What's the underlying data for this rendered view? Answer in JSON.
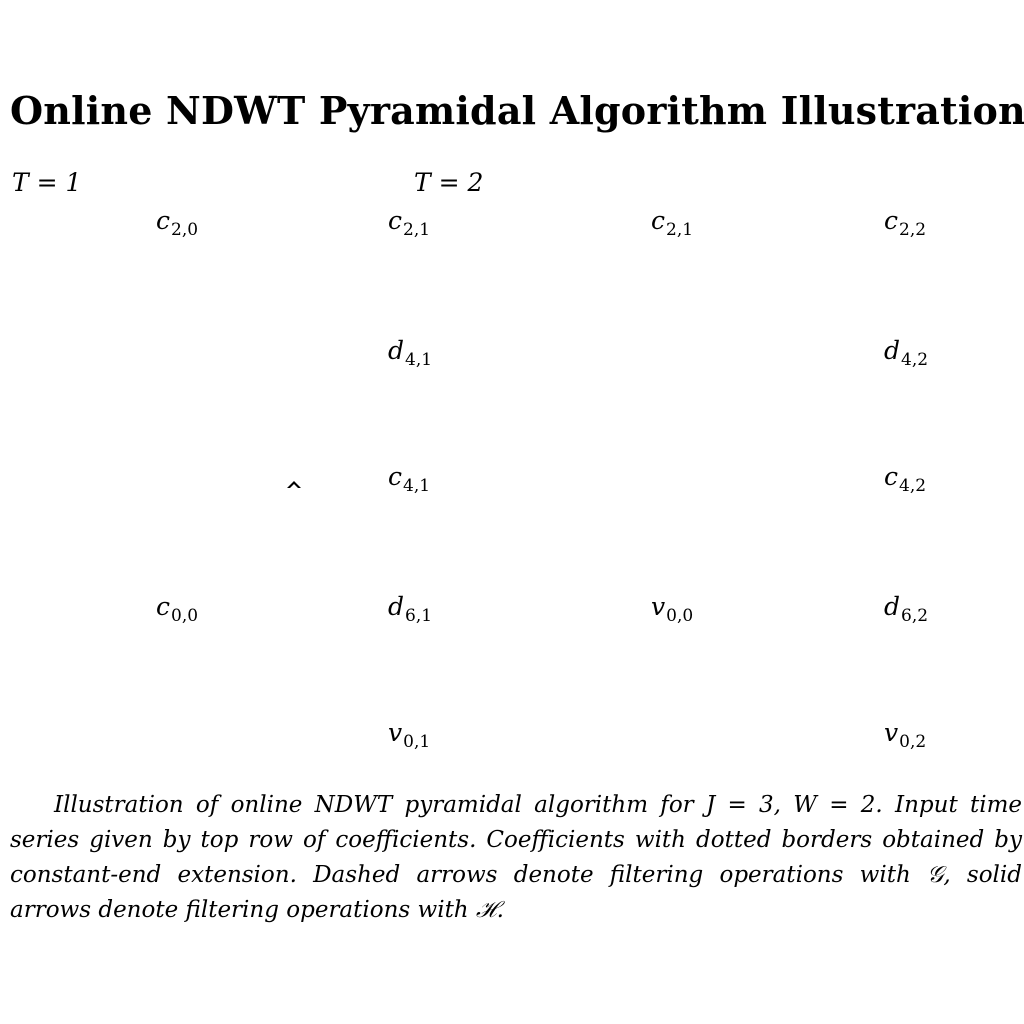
{
  "title": "Online NDWT Pyramidal Algorithm Illustration",
  "panels": [
    {
      "time_label": "T = 1"
    },
    {
      "time_label": "T = 2"
    }
  ],
  "coefficients": {
    "c20": {
      "sym": "c",
      "sub": "2,0"
    },
    "c00": {
      "sym": "c",
      "sub": "0,0"
    },
    "c21a": {
      "sym": "c",
      "sub": "2,1"
    },
    "d41": {
      "sym": "d",
      "sub": "4,1"
    },
    "c41": {
      "sym": "c",
      "sub": "4,1"
    },
    "d61": {
      "sym": "d",
      "sub": "6,1"
    },
    "v01": {
      "sym": "v",
      "sub": "0,1"
    },
    "c21b": {
      "sym": "c",
      "sub": "2,1"
    },
    "v00": {
      "sym": "v",
      "sub": "0,0"
    },
    "c22": {
      "sym": "c",
      "sub": "2,2"
    },
    "d42": {
      "sym": "d",
      "sub": "4,2"
    },
    "c42": {
      "sym": "c",
      "sub": "4,2"
    },
    "d62": {
      "sym": "d",
      "sub": "6,2"
    },
    "v02": {
      "sym": "v",
      "sub": "0,2"
    }
  },
  "caption": "Illustration of online NDWT pyramidal algorithm for J = 3, W = 2. Input time series given by top row of coefficients. Coefficients with dotted borders obtained by constant-end extension. Dashed arrows denote filtering operations with 𝒢, solid arrows denote filtering operations with ℋ."
}
